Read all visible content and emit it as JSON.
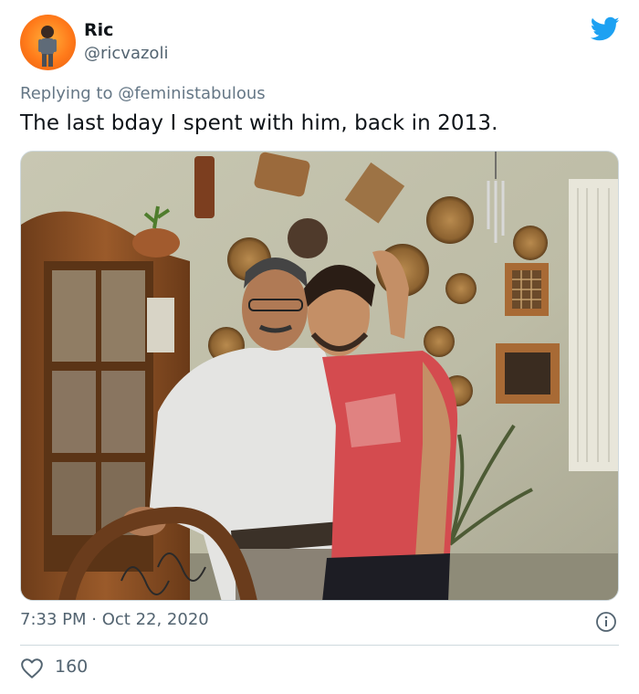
{
  "tweet": {
    "author_name": "Ric",
    "author_handle": "@ricvazoli",
    "reply_prefix": "Replying to",
    "reply_mention": "@feministabulous",
    "text": "The last bday I spent with him, back in 2013.",
    "time": "7:33 PM",
    "separator": "·",
    "date": "Oct 22, 2020",
    "likes": "160"
  },
  "icons": {
    "logo": "twitter-bird-icon",
    "info": "info-icon",
    "like": "heart-icon"
  },
  "colors": {
    "twitter_blue": "#1da1f2",
    "text_primary": "#0f1419",
    "text_secondary": "#536471",
    "avatar_bg": "#ff8a1f"
  }
}
